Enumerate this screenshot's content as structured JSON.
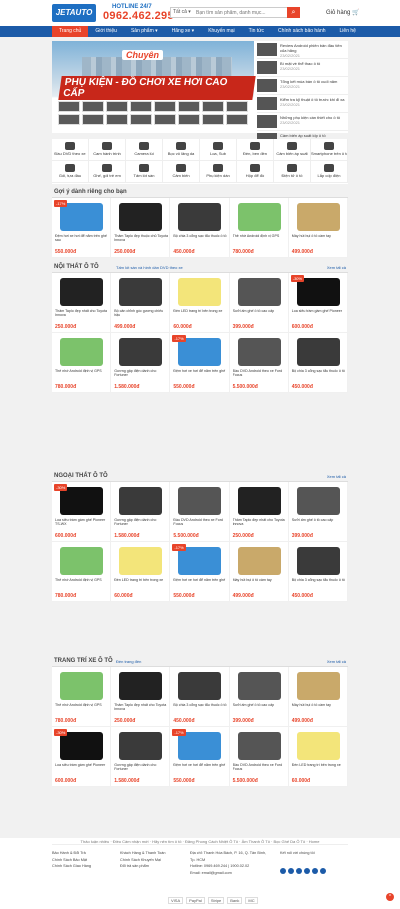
{
  "header": {
    "logo": "JETAUTO",
    "hotline_label": "HOTLINE 24/7",
    "hotline": "0962.462.295",
    "search_cat": "Tất cả ▾",
    "search_placeholder": "Bạn tìm sản phẩm, danh mục...",
    "cart": "Giỏ hàng"
  },
  "nav": [
    "Trang chủ",
    "Giới thiệu",
    "Sản phẩm ▾",
    "Hãng xe ▾",
    "Khuyến mại",
    "Tin tức",
    "Chính sách bảo hành",
    "Liên hệ"
  ],
  "banner": {
    "t1": "Chuyên",
    "t2": "PHỤ KIỆN - ĐỒ CHƠI XE HƠI CAO CẤP"
  },
  "side_news": [
    {
      "t": "Review Android phiên bản đầu tiên của hãng",
      "d": "23/02/2021"
    },
    {
      "t": "Bí mật về thể thao ô tô",
      "d": "23/02/2021"
    },
    {
      "t": "Tổng kết mùa bán ô tô cuối năm",
      "d": "23/02/2021"
    },
    {
      "t": "Kiểm tra kỹ thuật ô tô trước khi đi xa",
      "d": "23/02/2021"
    },
    {
      "t": "Những phụ kiện cần thiết cho ô tô",
      "d": "23/02/2021"
    },
    {
      "t": "Cảm biến áp suất lốp ô tô",
      "d": "23/02/2021"
    }
  ],
  "categories": [
    "Đầu DVD theo xe",
    "Cam hành trình",
    "Camera lùi",
    "Bọc vô lăng da",
    "Loa, Sub",
    "Đèn, ben đèn",
    "Cảm biến áp suất",
    "Smartphone trên ô tô",
    "Gối, tựa đầu",
    "Ghế, gối trẻ em",
    "Tấm lót sàn",
    "Cảm biến",
    "Phụ kiện dán",
    "Hộp để đồ",
    "Điện tử ô tô",
    "Lắp cốp điện"
  ],
  "sections": [
    {
      "title": "Gợi ý dành riêng cho bạn",
      "tabs": "",
      "more": "",
      "items": [
        {
          "n": "Đệm hơi xe hơi để nằm trên ghế sau",
          "o": "",
          "p": "550.000đ",
          "s": "-17%",
          "k": "k0"
        },
        {
          "n": "Thảm Taplo đẹp thuộc chủ Toyota Innova",
          "o": "",
          "p": "250.000đ",
          "s": "",
          "k": "k1"
        },
        {
          "n": "Bộ chia 3 cổng sạc tẩu thuốc ô tô",
          "o": "",
          "p": "450.000đ",
          "s": "",
          "k": "k2"
        },
        {
          "n": "Thẻ nhớ Android định vị GPS",
          "o": "",
          "p": "780.000đ",
          "s": "",
          "k": "k3"
        },
        {
          "n": "Máy hút bụi ô tô cầm tay",
          "o": "",
          "p": "499.000đ",
          "s": "",
          "k": "k4"
        }
      ]
    },
    {
      "title": "NỘI THẤT Ô TÔ",
      "tabs": "Tấm lót sàn và hình dán   DVD theo xe",
      "more": "Xem tất cả",
      "items": [
        {
          "n": "Thảm Taplo đẹp nhất cho Toyota Innova",
          "o": "",
          "p": "250.000đ",
          "s": "",
          "k": "k1"
        },
        {
          "n": "Bộ cân chỉnh góc gương chiếu hậu",
          "o": "",
          "p": "499.000đ",
          "s": "",
          "k": "k2"
        },
        {
          "n": "Đèn LED trang trí bên trong xe",
          "o": "",
          "p": "60.000đ",
          "s": "",
          "k": "k5"
        },
        {
          "n": "Sưởi ấm ghế ô tô cao cấp",
          "o": "",
          "p": "399.000đ",
          "s": "",
          "k": "k6"
        },
        {
          "n": "Loa siêu trầm gầm ghế Pioneer",
          "o": "",
          "p": "600.000đ",
          "s": "-30%",
          "k": "k7"
        },
        {
          "n": "Thẻ nhớ Android định vị GPS",
          "o": "",
          "p": "780.000đ",
          "s": "",
          "k": "k3"
        },
        {
          "n": "Gương gập điện dành cho Fortuner",
          "o": "",
          "p": "1.580.000đ",
          "s": "",
          "k": "k2"
        },
        {
          "n": "Đệm hơi xe hơi để nằm trên ghế",
          "o": "",
          "p": "550.000đ",
          "s": "-17%",
          "k": "k0"
        },
        {
          "n": "Đầu DVD Android theo xe Ford Focus",
          "o": "",
          "p": "5.500.000đ",
          "s": "",
          "k": "k6"
        },
        {
          "n": "Bộ chia 3 cổng sạc tẩu thuốc ô tô",
          "o": "",
          "p": "450.000đ",
          "s": "",
          "k": "k2"
        }
      ]
    },
    {
      "title": "NGOẠI THẤT Ô TÔ",
      "tabs": "",
      "more": "Xem tất cả",
      "items": [
        {
          "n": "Loa siêu trầm gầm ghế Pioneer TS-WX",
          "o": "",
          "p": "600.000đ",
          "s": "-30%",
          "k": "k7"
        },
        {
          "n": "Gương gập điện dành cho Fortuner",
          "o": "",
          "p": "1.580.000đ",
          "s": "",
          "k": "k2"
        },
        {
          "n": "Đầu DVD Android theo xe Ford Focus",
          "o": "",
          "p": "5.500.000đ",
          "s": "",
          "k": "k6"
        },
        {
          "n": "Thảm Taplo đẹp nhất cho Toyota Innova",
          "o": "",
          "p": "250.000đ",
          "s": "",
          "k": "k1"
        },
        {
          "n": "Sưởi ấm ghế ô tô cao cấp",
          "o": "",
          "p": "399.000đ",
          "s": "",
          "k": "k6"
        },
        {
          "n": "Thẻ nhớ Android định vị GPS",
          "o": "",
          "p": "780.000đ",
          "s": "",
          "k": "k3"
        },
        {
          "n": "Đèn LED trang trí bên trong xe",
          "o": "",
          "p": "60.000đ",
          "s": "",
          "k": "k5"
        },
        {
          "n": "Đệm hơi xe hơi để nằm trên ghế",
          "o": "",
          "p": "550.000đ",
          "s": "-17%",
          "k": "k0"
        },
        {
          "n": "Máy hút bụi ô tô cầm tay",
          "o": "",
          "p": "499.000đ",
          "s": "",
          "k": "k4"
        },
        {
          "n": "Bộ chia 3 cổng sạc tẩu thuốc ô tô",
          "o": "",
          "p": "450.000đ",
          "s": "",
          "k": "k2"
        }
      ]
    },
    {
      "title": "TRANG TRÍ XE Ô TÔ",
      "tabs": "Đèn   trang đèn",
      "more": "Xem tất cả",
      "items": [
        {
          "n": "Thẻ nhớ Android định vị GPS",
          "o": "",
          "p": "780.000đ",
          "s": "",
          "k": "k3"
        },
        {
          "n": "Thảm Taplo đẹp nhất cho Toyota Innova",
          "o": "",
          "p": "250.000đ",
          "s": "",
          "k": "k1"
        },
        {
          "n": "Bộ chia 3 cổng sạc tẩu thuốc ô tô",
          "o": "",
          "p": "450.000đ",
          "s": "",
          "k": "k2"
        },
        {
          "n": "Sưởi ấm ghế ô tô cao cấp",
          "o": "",
          "p": "399.000đ",
          "s": "",
          "k": "k6"
        },
        {
          "n": "Máy hút bụi ô tô cầm tay",
          "o": "",
          "p": "499.000đ",
          "s": "",
          "k": "k4"
        },
        {
          "n": "Loa siêu trầm gầm ghế Pioneer",
          "o": "",
          "p": "600.000đ",
          "s": "-30%",
          "k": "k7"
        },
        {
          "n": "Gương gập điện dành cho Fortuner",
          "o": "",
          "p": "1.580.000đ",
          "s": "",
          "k": "k2"
        },
        {
          "n": "Đệm hơi xe hơi để nằm trên ghế",
          "o": "",
          "p": "550.000đ",
          "s": "-17%",
          "k": "k0"
        },
        {
          "n": "Đầu DVD Android theo xe Ford Focus",
          "o": "",
          "p": "5.500.000đ",
          "s": "",
          "k": "k6"
        },
        {
          "n": "Đèn LED trang trí bên trong xe",
          "o": "",
          "p": "60.000đ",
          "s": "",
          "k": "k5"
        }
      ]
    }
  ],
  "footer": {
    "bar": "Thảo luận nhiều · Điều Cảm nhận mới · Hãy nên tìm ô tô · Đăng Phong Cách Nhiệt Ô Tô · Âm Thanh Ô Tô · Bọc Ghế Da Ô Tô · Home",
    "col1": [
      "Bảo Hành & Đổi Trả",
      "Chính Sách Bảo Mật",
      "Chính Sách Giao Hàng"
    ],
    "col2": [
      "Khách Hàng & Thanh Toán",
      "Chính Sách Khuyến Mại",
      "Đổi trả sản phẩm"
    ],
    "col3": [
      "Địa chỉ: Thanh Hóa Bách, P. 16, Q. Tân Bình, Tp. HCM",
      "Hotline: 0969.469.244 | 1900.02.02",
      "Email: email@gmail.com"
    ],
    "col4": "Kết nối với chúng tôi",
    "pay": [
      "VISA",
      "PayPal",
      "Stripe",
      "Bank",
      "MC"
    ]
  },
  "totop": "^"
}
